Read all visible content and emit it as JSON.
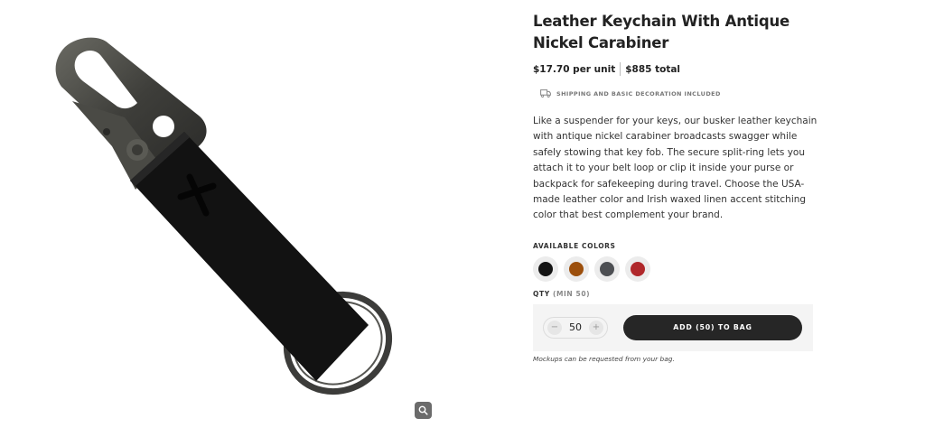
{
  "product": {
    "title": "Leather Keychain With Antique Nickel Carabiner",
    "unit_price": "$17.70 per unit",
    "total_price": "$885 total",
    "shipping_icon": "truck-icon",
    "shipping_text": "SHIPPING AND BASIC DECORATION INCLUDED",
    "description": "Like a suspender for your keys, our busker leather keychain with antique nickel carabiner broadcasts swagger while safely stowing that key fob. The secure split-ring lets you attach it to your belt loop or clip it inside your purse or backpack for safekeeping during travel. Choose the USA-made leather color and Irish waxed linen accent stitching color that best complement your brand."
  },
  "image": {
    "zoom_icon": "magnifier-icon"
  },
  "colors": {
    "label": "AVAILABLE COLORS",
    "swatches": [
      {
        "name": "black",
        "hex": "#141414"
      },
      {
        "name": "brown",
        "hex": "#9c4f0c"
      },
      {
        "name": "gray",
        "hex": "#4d4f53"
      },
      {
        "name": "red",
        "hex": "#b0282b"
      }
    ]
  },
  "quantity": {
    "label": "QTY",
    "min_label": "(MIN 50)",
    "value": "50",
    "decrement": "−",
    "increment": "+"
  },
  "cart": {
    "add_label": "ADD (50) TO BAG",
    "note": "Mockups can be requested from your bag."
  }
}
